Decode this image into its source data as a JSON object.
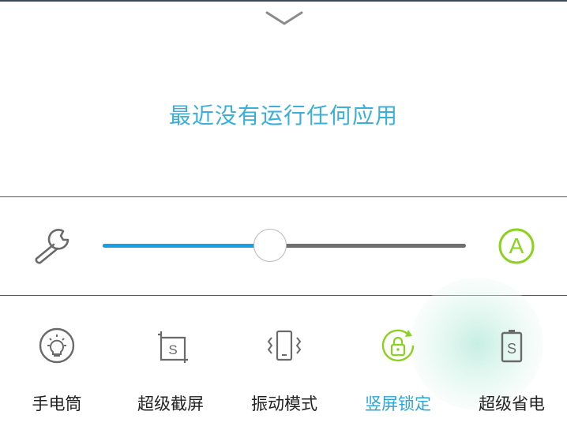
{
  "recent_apps": {
    "empty_message": "最近没有运行任何应用"
  },
  "brightness": {
    "level": 0.46,
    "wrench_icon": "wrench-icon",
    "auto_icon": "auto-brightness-icon",
    "auto_letter": "A",
    "colors": {
      "fill": "#1aa0e2",
      "track": "#6e6e6e",
      "auto": "#8ad21e"
    }
  },
  "toggles": [
    {
      "id": "flashlight",
      "label": "手电筒",
      "icon": "flashlight-icon",
      "active": false
    },
    {
      "id": "super-screenshot",
      "label": "超级截屏",
      "icon": "screenshot-crop-icon",
      "icon_letter": "S",
      "active": false
    },
    {
      "id": "vibrate-mode",
      "label": "振动模式",
      "icon": "vibrate-phone-icon",
      "active": false
    },
    {
      "id": "portrait-lock",
      "label": "竖屏锁定",
      "icon": "rotation-lock-icon",
      "active": true
    },
    {
      "id": "power-saver",
      "label": "超级省电",
      "icon": "battery-saver-icon",
      "icon_letter": "S",
      "active": false
    }
  ],
  "colors": {
    "active_text": "#2aa6d6",
    "active_icon": "#8ad21e",
    "inactive_icon": "#6a6a6a"
  }
}
